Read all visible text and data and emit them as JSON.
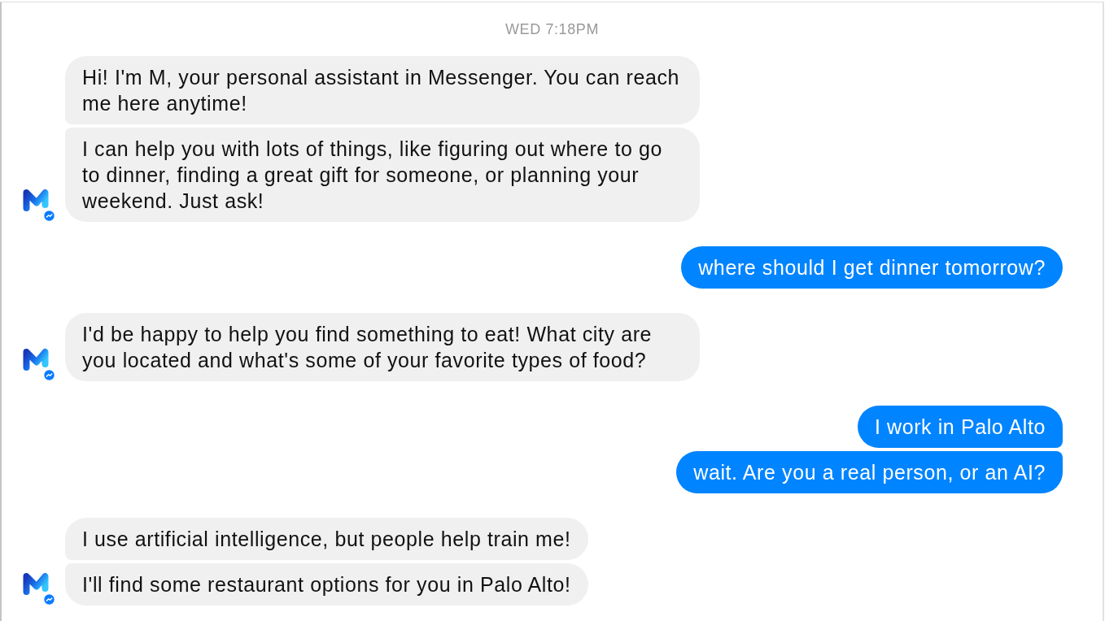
{
  "timestamp": "WED 7:18PM",
  "groups": [
    {
      "kind": "received",
      "messages": [
        "Hi! I'm M, your personal assistant in Messenger. You can reach me here anytime!",
        "I can help you with lots of things, like figuring out where to go to dinner, finding a great gift for someone, or planning your weekend. Just ask!"
      ]
    },
    {
      "kind": "sent",
      "messages": [
        "where should I get dinner tomorrow?"
      ]
    },
    {
      "kind": "received",
      "messages": [
        "I'd be happy to help you find something to eat! What city are you located and what's some of your favorite types of food?"
      ]
    },
    {
      "kind": "sent",
      "messages": [
        "I work in Palo Alto",
        "wait. Are you a real person, or an AI?"
      ]
    },
    {
      "kind": "received",
      "messages": [
        "I use artificial intelligence, but people help train me!",
        "I'll find some restaurant options for you in Palo Alto!"
      ]
    }
  ]
}
